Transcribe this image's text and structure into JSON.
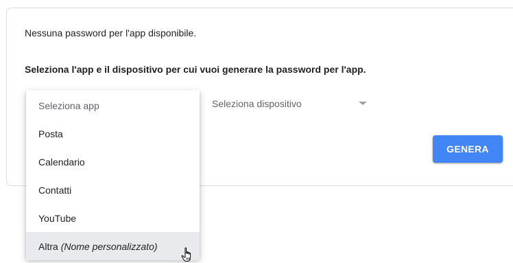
{
  "card": {
    "no_password_text": "Nessuna password per l'app disponibile.",
    "instruction_text": "Seleziona l'app e il dispositivo per cui vuoi generare la password per l'app."
  },
  "device_select": {
    "label": "Seleziona dispositivo"
  },
  "generate_button": {
    "label": "GENERA"
  },
  "app_menu": {
    "placeholder": "Seleziona app",
    "items": [
      {
        "label": "Posta"
      },
      {
        "label": "Calendario"
      },
      {
        "label": "Contatti"
      },
      {
        "label": "YouTube"
      }
    ],
    "other_item": {
      "label": "Altra",
      "hint": "(Nome personalizzato)"
    }
  },
  "colors": {
    "accent": "#4285f4",
    "hover": "#e8eaed",
    "border": "#dadce0"
  },
  "icons": {
    "device_dropdown": "caret-down-icon",
    "pointer": "hand-pointer-cursor-icon"
  }
}
